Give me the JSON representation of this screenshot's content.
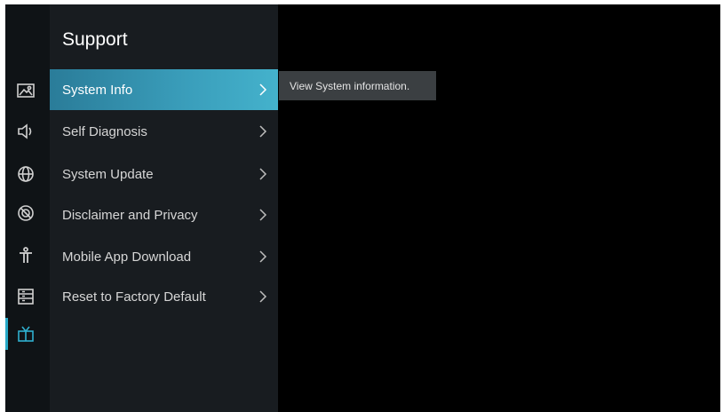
{
  "menu": {
    "title": "Support",
    "items": [
      {
        "label": "System Info"
      },
      {
        "label": "Self Diagnosis"
      },
      {
        "label": "System Update"
      },
      {
        "label": "Disclaimer and Privacy"
      },
      {
        "label": "Mobile App Download"
      },
      {
        "label": "Reset to Factory Default"
      }
    ],
    "selected_index": 0
  },
  "tooltip": {
    "text": "View System information."
  },
  "rail": {
    "icons": [
      "picture-icon",
      "sound-icon",
      "network-icon",
      "blocked-icon",
      "accessibility-icon",
      "system-list-icon",
      "support-tv-icon"
    ],
    "active_icon": "support-tv-icon"
  },
  "colors": {
    "accent": "#2f9ab8",
    "menu_bg": "#181c20",
    "rail_bg": "#0f1316",
    "tooltip_bg": "#3b3f42"
  }
}
